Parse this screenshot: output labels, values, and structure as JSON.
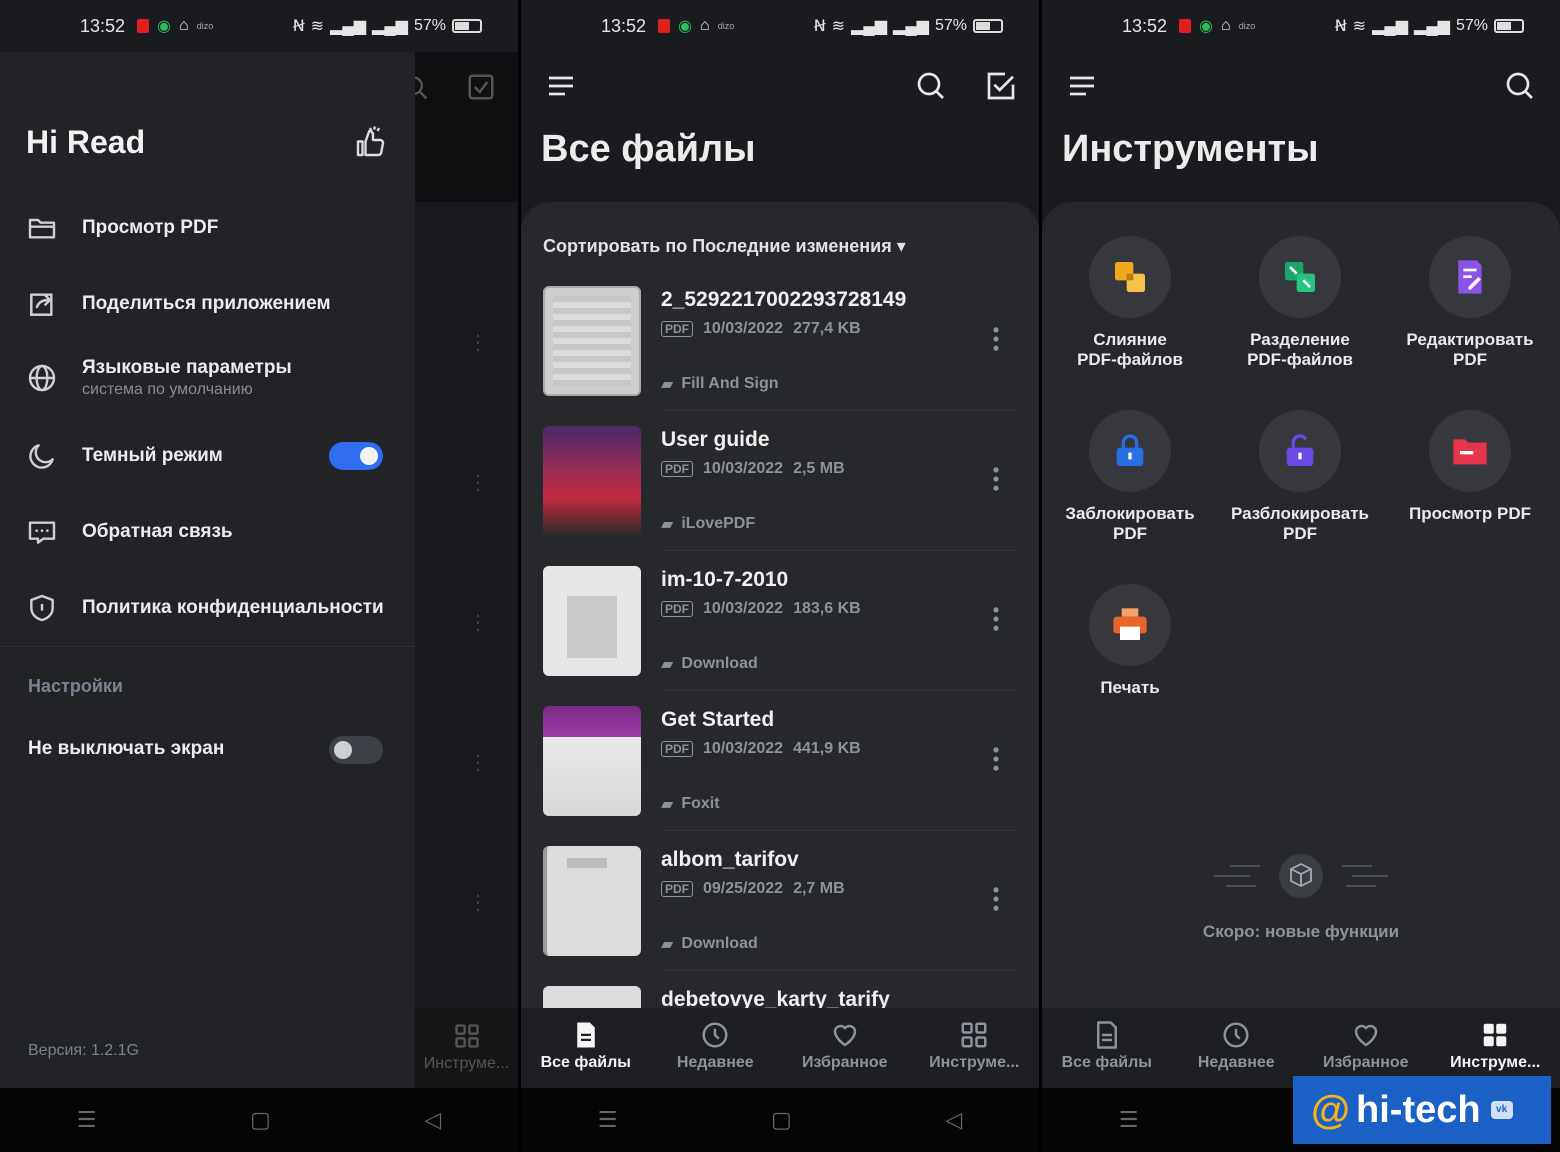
{
  "status": {
    "time": "13:52",
    "battery": "57%"
  },
  "panel1": {
    "app_title": "Hi Read",
    "items": [
      {
        "label": "Просмотр PDF",
        "icon": "folder-icon"
      },
      {
        "label": "Поделиться приложением",
        "icon": "share-icon"
      },
      {
        "label": "Языковые параметры",
        "sub": "система по умолчанию",
        "icon": "globe-icon"
      },
      {
        "label": "Темный режим",
        "icon": "moon-icon",
        "toggle": true
      },
      {
        "label": "Обратная связь",
        "icon": "feedback-icon"
      },
      {
        "label": "Политика конфиденциальности",
        "icon": "shield-icon"
      }
    ],
    "settings_title": "Настройки",
    "keep_screen_label": "Не выключать экран",
    "keep_screen_on": false,
    "version": "Версия: 1.2.1G",
    "bg_tab_label": "Инструме..."
  },
  "panel2": {
    "title": "Все файлы",
    "sort_label": "Сортировать по Последние изменения",
    "files": [
      {
        "name": "2_5292217002293728149",
        "type": "PDF",
        "date": "10/03/2022",
        "size": "277,4 KB",
        "folder": "Fill And Sign"
      },
      {
        "name": "User guide",
        "type": "PDF",
        "date": "10/03/2022",
        "size": "2,5 MB",
        "folder": "iLovePDF"
      },
      {
        "name": "im-10-7-2010",
        "type": "PDF",
        "date": "10/03/2022",
        "size": "183,6 KB",
        "folder": "Download"
      },
      {
        "name": "Get Started",
        "type": "PDF",
        "date": "10/03/2022",
        "size": "441,9 KB",
        "folder": "Foxit"
      },
      {
        "name": "albom_tarifov",
        "type": "PDF",
        "date": "09/25/2022",
        "size": "2,7 MB",
        "folder": "Download"
      },
      {
        "name": "debetovye_karty_tarify"
      }
    ]
  },
  "tabs": [
    "Все файлы",
    "Недавнее",
    "Избранное",
    "Инструме..."
  ],
  "panel3": {
    "title": "Инструменты",
    "tools": [
      {
        "label1": "Слияние",
        "label2": "PDF-файлов",
        "icon": "merge-icon",
        "color": "#f0a81c"
      },
      {
        "label1": "Разделение",
        "label2": "PDF-файлов",
        "icon": "split-icon",
        "color": "#1aa56b"
      },
      {
        "label1": "Редактировать",
        "label2": "PDF",
        "icon": "edit-icon",
        "color": "#8a55e6"
      },
      {
        "label1": "Заблокировать",
        "label2": "PDF",
        "icon": "lock-icon",
        "color": "#2a6ee6"
      },
      {
        "label1": "Разблокировать",
        "label2": "PDF",
        "icon": "unlock-icon",
        "color": "#6a4ae6"
      },
      {
        "label1": "Просмотр PDF",
        "label2": "",
        "icon": "folder-icon",
        "color": "#e6354a"
      },
      {
        "label1": "Печать",
        "label2": "",
        "icon": "print-icon",
        "color": "#e8652a"
      }
    ],
    "soon_label": "Скоро: новые функции"
  },
  "watermark": "hi-tech",
  "colors": {
    "accent": "#2f6cf1",
    "background": "#1a1b1f",
    "card": "#26282c"
  }
}
